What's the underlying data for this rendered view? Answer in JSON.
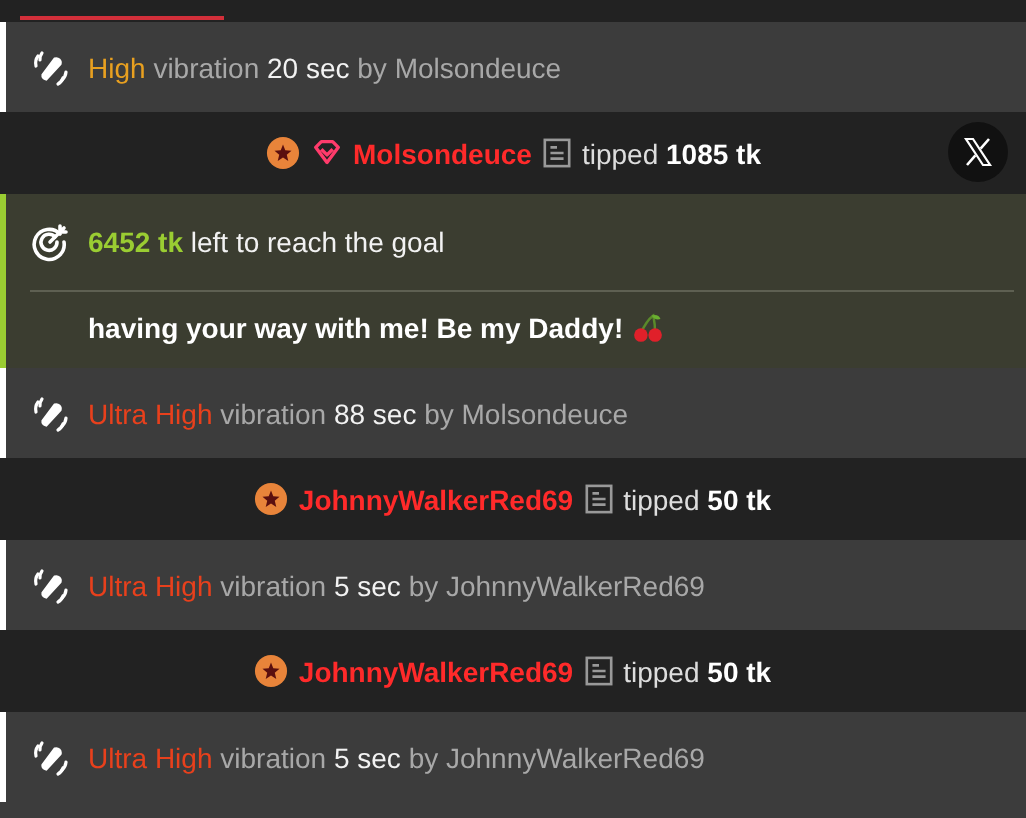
{
  "feed": [
    {
      "kind": "vibration",
      "intensity": "High",
      "color": "#e8a020",
      "action": "vibration",
      "duration": "20 sec",
      "preposition": "by",
      "user": "Molsondeuce"
    },
    {
      "kind": "tip",
      "badges": [
        {
          "kind": "star"
        },
        {
          "kind": "diamond"
        }
      ],
      "user": "Molsondeuce",
      "action": "tipped",
      "amount": "1085 tk",
      "share_button": true
    },
    {
      "kind": "goal",
      "amount": "6452 tk",
      "text": "left to reach the goal",
      "message": "having your way with me! Be my Daddy!"
    },
    {
      "kind": "vibration",
      "intensity": "Ultra High",
      "color": "#e8401c",
      "action": "vibration",
      "duration": "88 sec",
      "preposition": "by",
      "user": "Molsondeuce"
    },
    {
      "kind": "tip",
      "badges": [
        {
          "kind": "star"
        }
      ],
      "user": "JohnnyWalkerRed69",
      "action": "tipped",
      "amount": "50 tk",
      "share_button": false
    },
    {
      "kind": "vibration",
      "intensity": "Ultra High",
      "color": "#e8401c",
      "action": "vibration",
      "duration": "5 sec",
      "preposition": "by",
      "user": "JohnnyWalkerRed69"
    },
    {
      "kind": "tip",
      "badges": [
        {
          "kind": "star"
        }
      ],
      "user": "JohnnyWalkerRed69",
      "action": "tipped",
      "amount": "50 tk",
      "share_button": false
    },
    {
      "kind": "vibration",
      "intensity": "Ultra High",
      "color": "#e8401c",
      "action": "vibration",
      "duration": "5 sec",
      "preposition": "by",
      "user": "JohnnyWalkerRed69"
    }
  ]
}
